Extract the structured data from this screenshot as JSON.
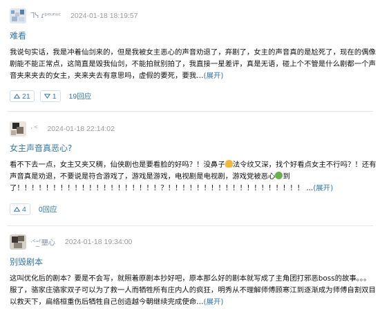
{
  "reviews": [
    {
      "avatar_name": "ᒣᓭ ɾᵖᵉᵘⁿᵘᶜ",
      "timestamp": "2024-01-18 18:19:57",
      "title": "难看",
      "body_lines": [
        "我说句实话，我是冲着仙剑来的，但是我被女主恶心的声音劝退了，弃剧了，女主的声音真的是尬死了，现在的偶像",
        "剧能不能正常点，这简直是毁我仙剑，不能拍就别拍了，我直接一星差评，真是无语，碰上个不管是什么剧都一个声",
        "音夹来夹去的女主，夹来夹去有意思吗，虚假的要死，要我…"
      ],
      "expand_label": "(展开)",
      "up_count": "21",
      "down_count": "1",
      "reply_label": "19回应"
    },
    {
      "avatar_name": "ᐧ ᑉ",
      "timestamp": "2024-01-18 22:14:02",
      "title": "女主声音真恶心?",
      "body_lines_a": "看不下去一点，女主又夹又稠，仙侠剧也是要看脸的好吗？！没鼻子",
      "body_lines_b": "法令纹又深，找个好看点女主不行吗？！还有",
      "body_line2_a": "声音真是劝退，不要说是符合游戏了，游戏是游戏，电视剧是电视剧，游戏党被恶心",
      "body_line2_b": "到",
      "body_line3": "了！！！！！！！！！！！！！！！！！！！！？！！！！！！！！！！！！！！！！！！！ ...",
      "expand_label": "(展开)",
      "up_count": "4",
      "reply_label": "0回应"
    },
    {
      "avatar_name": "ᐧᑉ⁼̲ᶠ壨心",
      "timestamp": "2024-01-18 19:34:00",
      "title": "别毁剧本",
      "body_lines": [
        "这叫优化后的剧本？要是不会写，就照着原剧本抄好吧，原本那么好的剧本就写成了主角团打邪恶boss的故事。。。",
        "服了，骆家庄骆家双子可以为了救一人而牺牲所有庄内人的疯狂，明秀从不理解师傅顾寒江到逐渐成为师傅自割双目",
        "以救天下，扁络桓重伤后牺牲自己创造越今朝继续完成使命…"
      ],
      "expand_label": "(展开)"
    }
  ]
}
